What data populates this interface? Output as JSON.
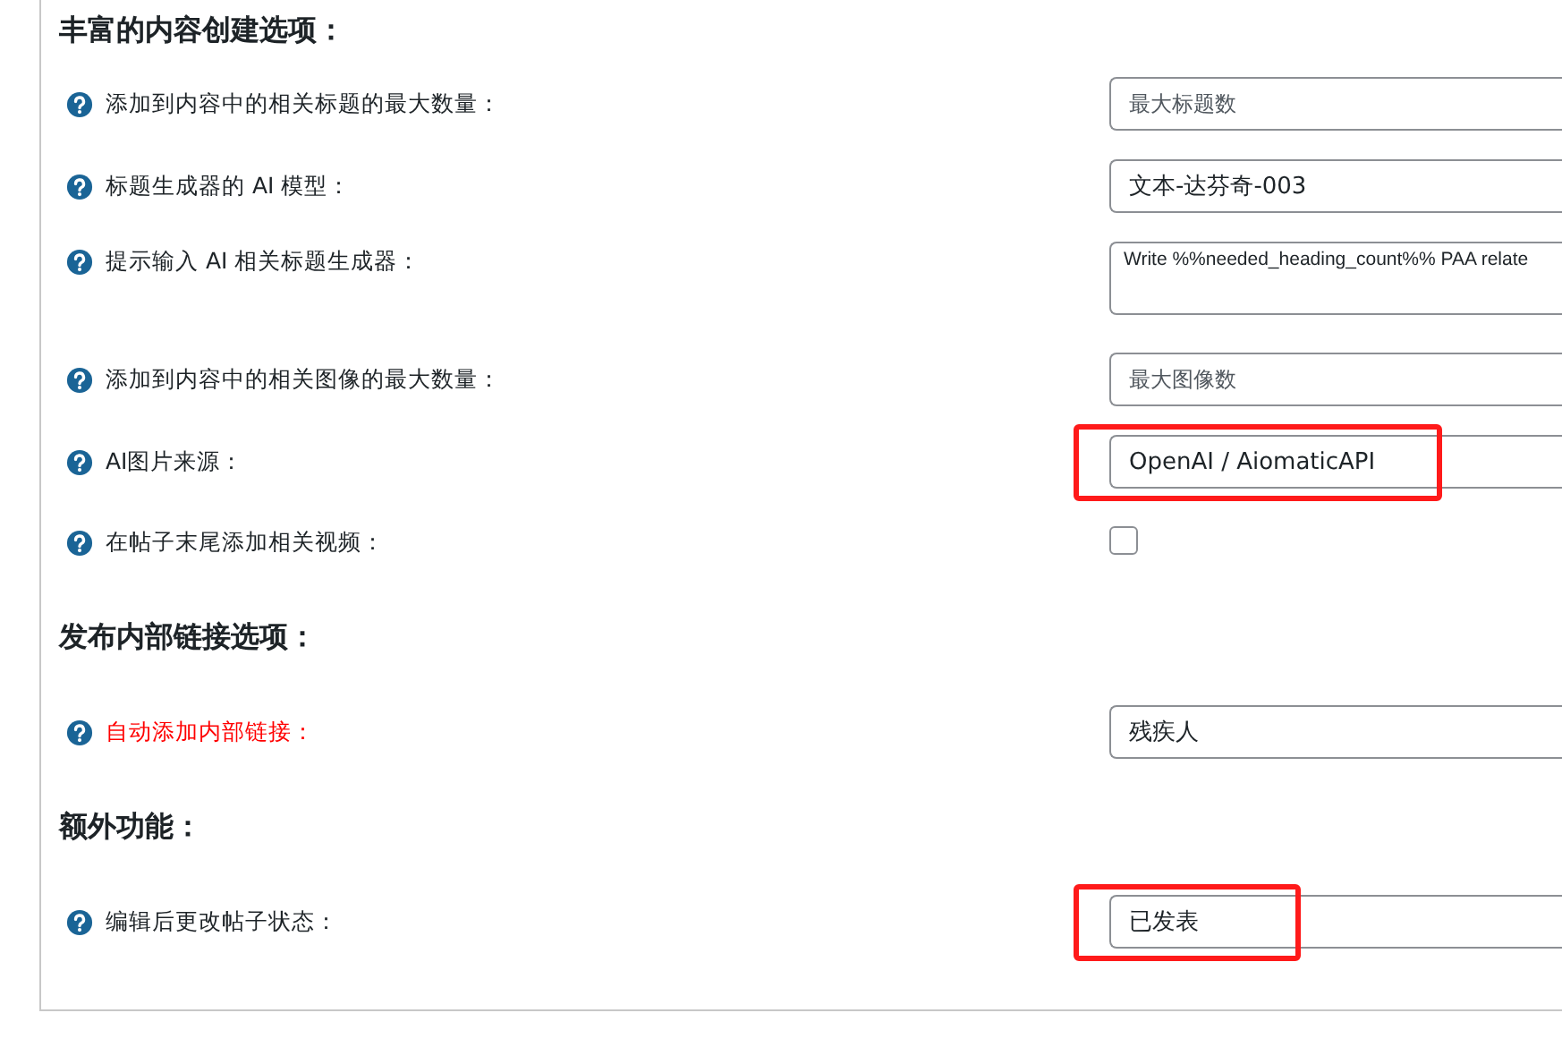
{
  "sections": [
    {
      "title": "丰富的内容创建选项：",
      "rows": [
        {
          "kind": "input",
          "label": "添加到内容中的相关标题的最大数量：",
          "placeholder": "最大标题数"
        },
        {
          "kind": "input",
          "label": "标题生成器的 AI 模型：",
          "value": "文本-达芬奇-003"
        },
        {
          "kind": "textarea",
          "label": "提示输入 AI 相关标题生成器：",
          "value": "Write %%needed_heading_count%% PAA relate"
        },
        {
          "kind": "input",
          "label": "添加到内容中的相关图像的最大数量：",
          "placeholder": "最大图像数"
        },
        {
          "kind": "input",
          "label": "AI图片来源：",
          "value": "OpenAI / AiomaticAPI",
          "highlighted": true
        },
        {
          "kind": "checkbox",
          "label": "在帖子末尾添加相关视频：",
          "checked": false
        }
      ]
    },
    {
      "title": "发布内部链接选项：",
      "rows": [
        {
          "kind": "input",
          "label": "自动添加内部链接：",
          "value": "残疾人",
          "alert": true
        }
      ]
    },
    {
      "title": "额外功能：",
      "rows": [
        {
          "kind": "input",
          "label": "编辑后更改帖子状态：",
          "value": "已发表",
          "highlighted": true
        }
      ]
    }
  ]
}
